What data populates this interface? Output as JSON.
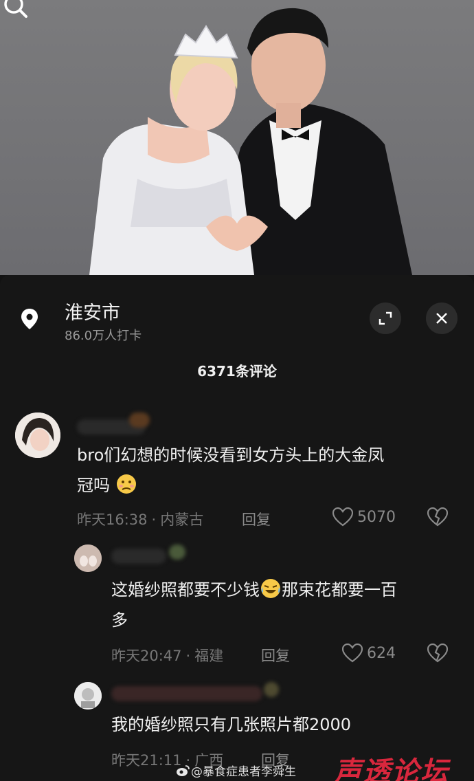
{
  "location": {
    "title": "淮安市",
    "subtitle": "86.0万人打卡"
  },
  "comments_count": "6371条评论",
  "comments": [
    {
      "text_line1": "bro们幻想的时候没看到女方头上的大金凤",
      "text_line2": "冠吗",
      "time": "昨天16:38",
      "region": "内蒙古",
      "reply": "回复",
      "likes": "5070"
    },
    {
      "text_line1": "这婚纱照都要不少钱",
      "text_line1b": "那束花都要一百",
      "text_line2": "多",
      "time": "昨天20:47",
      "region": "福建",
      "reply": "回复",
      "likes": "624"
    },
    {
      "text_line1": "我的婚纱照只有几张照片都2000",
      "time": "昨天21:11",
      "region": "广西",
      "reply": "回复"
    }
  ],
  "separator": "·",
  "watermark": {
    "user": "@暴食症患者李舜生",
    "logo": "声透论坛"
  },
  "colors": {
    "sheet_bg": "#161616",
    "logo_red": "#d9273d"
  }
}
